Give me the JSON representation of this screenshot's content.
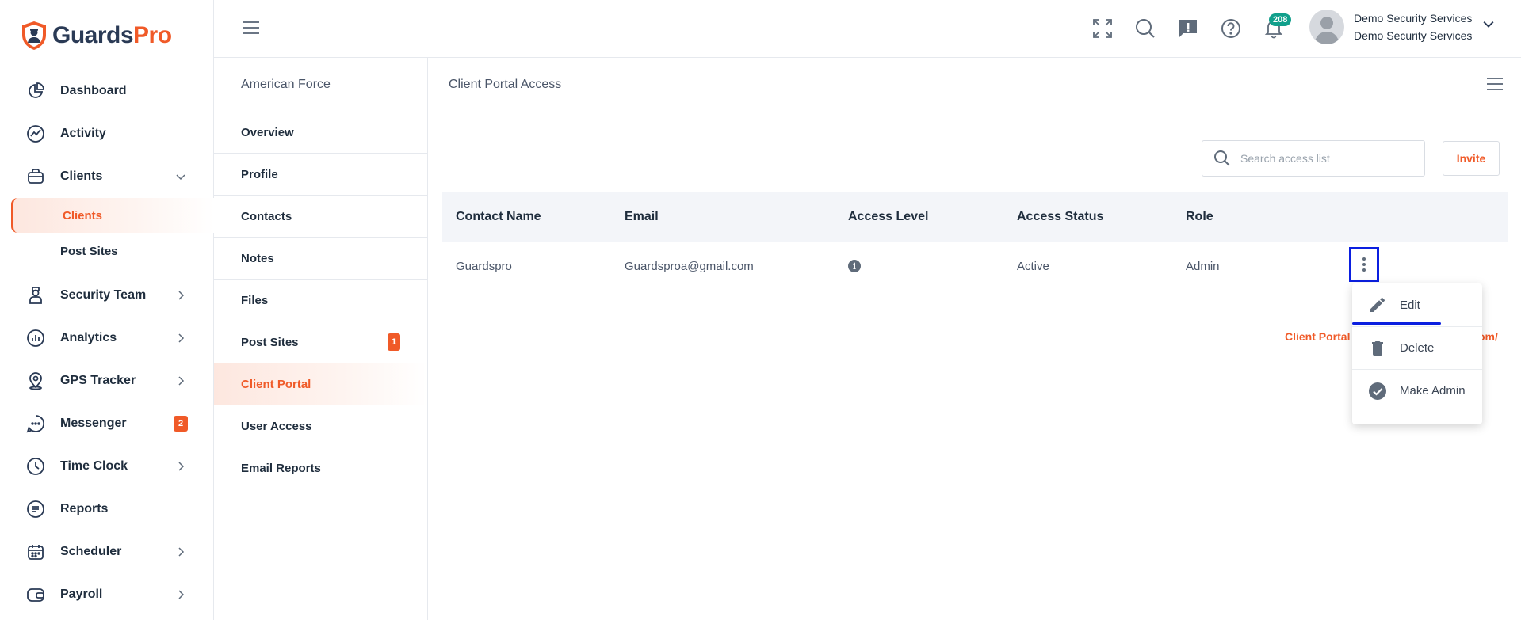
{
  "brand": {
    "part1": "Guards",
    "part2": "Pro"
  },
  "sidebar": {
    "items": [
      {
        "label": "Dashboard"
      },
      {
        "label": "Activity"
      },
      {
        "label": "Clients"
      },
      {
        "label": "Clients"
      },
      {
        "label": "Post Sites"
      },
      {
        "label": "Security Team"
      },
      {
        "label": "Analytics"
      },
      {
        "label": "GPS Tracker"
      },
      {
        "label": "Messenger",
        "badge": "2"
      },
      {
        "label": "Time Clock"
      },
      {
        "label": "Reports"
      },
      {
        "label": "Scheduler"
      },
      {
        "label": "Payroll"
      }
    ]
  },
  "header": {
    "notification_count": "208",
    "user_name": "Demo Security Services",
    "user_company": "Demo Security Services"
  },
  "client_menu": {
    "title": "American Force",
    "items": [
      {
        "label": "Overview"
      },
      {
        "label": "Profile"
      },
      {
        "label": "Contacts"
      },
      {
        "label": "Notes"
      },
      {
        "label": "Files"
      },
      {
        "label": "Post Sites",
        "badge": "1"
      },
      {
        "label": "Client Portal"
      },
      {
        "label": "User Access"
      },
      {
        "label": "Email Reports"
      }
    ]
  },
  "main": {
    "title": "Client Portal Access",
    "search_placeholder": "Search access list",
    "invite_label": "Invite",
    "columns": [
      "Contact Name",
      "Email",
      "Access Level",
      "Access Status",
      "Role"
    ],
    "rows": [
      {
        "name": "Guardspro",
        "email": "Guardsproa@gmail.com",
        "status": "Active",
        "role": "Admin"
      }
    ],
    "portal_link_prefix": "Client Portal",
    "portal_link_suffix": "om/"
  },
  "row_menu": {
    "items": [
      {
        "label": "Edit",
        "icon": "pencil-icon"
      },
      {
        "label": "Delete",
        "icon": "trash-icon"
      },
      {
        "label": "Make Admin",
        "icon": "check-circle-icon"
      }
    ]
  },
  "colors": {
    "accent": "#f05a28",
    "highlight": "#0b1fe0"
  }
}
